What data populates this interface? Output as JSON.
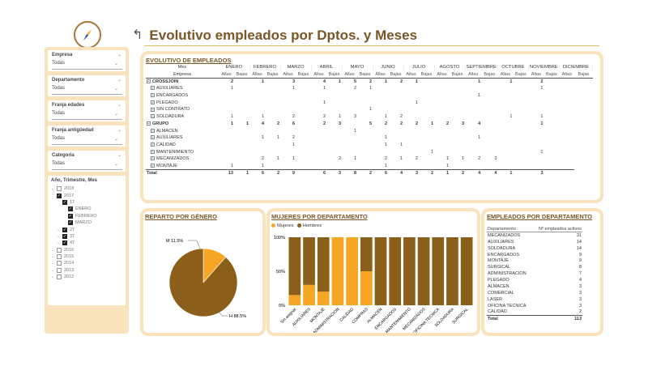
{
  "header": {
    "title": "Evolutivo empleados por Dptos. y Meses"
  },
  "colors": {
    "accent": "#f6a623",
    "brown": "#8b5e1a",
    "panel_bg": "#f9e3bd"
  },
  "filters": [
    {
      "label": "Empresa",
      "value": "Todas"
    },
    {
      "label": "Departamento",
      "value": "Todas"
    },
    {
      "label": "Franja edades",
      "value": "Todas"
    },
    {
      "label": "Franja antigüedad",
      "value": "Todas"
    },
    {
      "label": "Categoria",
      "value": "Todas"
    }
  ],
  "date_tree": {
    "title": "Año, Trimestre, Mes",
    "items": [
      {
        "label": "2018",
        "level": 0,
        "checked": false,
        "exp": "v"
      },
      {
        "label": "2017",
        "level": 0,
        "checked": true,
        "exp": "^"
      },
      {
        "label": "1T",
        "level": 1,
        "checked": true,
        "exp": "^"
      },
      {
        "label": "ENERO",
        "level": 2,
        "checked": true,
        "exp": ""
      },
      {
        "label": "FEBRERO",
        "level": 2,
        "checked": true,
        "exp": ""
      },
      {
        "label": "MARZO",
        "level": 2,
        "checked": true,
        "exp": ""
      },
      {
        "label": "2T",
        "level": 1,
        "checked": true,
        "exp": "v"
      },
      {
        "label": "3T",
        "level": 1,
        "checked": true,
        "exp": "v"
      },
      {
        "label": "4T",
        "level": 1,
        "checked": true,
        "exp": "v"
      },
      {
        "label": "2016",
        "level": 0,
        "checked": false,
        "exp": "v"
      },
      {
        "label": "2015",
        "level": 0,
        "checked": false,
        "exp": "v"
      },
      {
        "label": "2014",
        "level": 0,
        "checked": false,
        "exp": "v"
      },
      {
        "label": "2013",
        "level": 0,
        "checked": false,
        "exp": "v"
      },
      {
        "label": "2012",
        "level": 0,
        "checked": false,
        "exp": "v"
      }
    ]
  },
  "evolutivo": {
    "title": "EVOLUTIVO DE EMPLEADOS",
    "corner_top": "Mes",
    "corner_bottom": "Empresa",
    "months": [
      "ENERO",
      "FEBRERO",
      "MARZO",
      "ABRIL",
      "MAYO",
      "JUNIO",
      "JULIO",
      "AGOSTO",
      "SEPTIEMBRE",
      "OCTUBRE",
      "NOVIEMBRE",
      "DICIEMBRE"
    ],
    "altas": "Altas",
    "bajas": "Bajas",
    "rows": [
      {
        "name": "CROSSJOIN",
        "group": true,
        "vals": [
          "2",
          "",
          "1",
          "",
          "3",
          "",
          "4",
          "1",
          "5",
          "2",
          "1",
          "2",
          "1",
          "",
          "",
          "",
          "1",
          "",
          "1",
          "",
          "2",
          "",
          ""
        ]
      },
      {
        "name": "AUXILIARES",
        "vals": [
          "1",
          "",
          "",
          "",
          "1",
          "",
          "1",
          "",
          "2",
          "1",
          "",
          "",
          "",
          "",
          "",
          "",
          "",
          "",
          "",
          "",
          "1",
          "",
          ""
        ]
      },
      {
        "name": "ENCARGADOS",
        "vals": [
          "",
          "",
          "",
          "",
          "",
          "",
          "",
          "",
          "",
          "",
          "",
          "",
          "",
          "",
          "",
          "",
          "1",
          "",
          "",
          "",
          "",
          "",
          ""
        ]
      },
      {
        "name": "PLEGADO",
        "vals": [
          "",
          "",
          "",
          "",
          "",
          "",
          "1",
          "",
          "",
          "",
          "",
          "",
          "1",
          "",
          "",
          "",
          "",
          "",
          "",
          "",
          "",
          "",
          ""
        ]
      },
      {
        "name": "SIN CONTRATO",
        "vals": [
          "",
          "",
          "",
          "",
          "",
          "",
          "",
          "",
          "",
          "1",
          "",
          "",
          "",
          "",
          "",
          "",
          "",
          "",
          "",
          "",
          "",
          "",
          ""
        ]
      },
      {
        "name": "SOLDADURA",
        "vals": [
          "1",
          "",
          "1",
          "",
          "2",
          "",
          "2",
          "1",
          "3",
          "",
          "1",
          "2",
          "",
          "",
          "",
          "",
          "",
          "",
          "1",
          "",
          "1",
          "",
          ""
        ]
      },
      {
        "name": "GRUPO",
        "group": true,
        "vals": [
          "1",
          "1",
          "4",
          "2",
          "6",
          "",
          "2",
          "3",
          "",
          "5",
          "2",
          "2",
          "2",
          "1",
          "2",
          "3",
          "4",
          "",
          "",
          "",
          "1",
          "",
          ""
        ]
      },
      {
        "name": "ALMACEN",
        "vals": [
          "",
          "",
          "",
          "",
          "",
          "",
          "",
          "",
          "1",
          "",
          "",
          "",
          "",
          "",
          "",
          "",
          "",
          "",
          "",
          "",
          "",
          "",
          ""
        ]
      },
      {
        "name": "AUXILIARES",
        "vals": [
          "",
          "",
          "1",
          "1",
          "2",
          "",
          "",
          "",
          "",
          "",
          "1",
          "",
          "",
          "",
          "",
          "",
          "1",
          "",
          "",
          "",
          "",
          "",
          ""
        ]
      },
      {
        "name": "CALIDAD",
        "vals": [
          "",
          "",
          "",
          "",
          "1",
          "",
          "",
          "",
          "",
          "",
          "1",
          "1",
          "",
          "",
          "",
          "",
          "",
          "",
          "",
          "",
          "",
          "",
          ""
        ]
      },
      {
        "name": "MANTENIMIENTO",
        "vals": [
          "",
          "",
          "",
          "",
          "",
          "",
          "",
          "",
          "",
          "",
          "",
          "",
          "",
          "1",
          "",
          "",
          "",
          "",
          "",
          "",
          "1",
          "",
          ""
        ]
      },
      {
        "name": "MECANIZADOS",
        "vals": [
          "",
          "",
          "2",
          "1",
          "1",
          "",
          "",
          "2",
          "1",
          "",
          "2",
          "1",
          "2",
          "",
          "1",
          "1",
          "2",
          "3",
          "",
          "",
          "",
          "",
          ""
        ]
      },
      {
        "name": "MONTAJE",
        "vals": [
          "1",
          "",
          "1",
          "",
          "",
          "",
          "",
          "",
          "",
          "",
          "1",
          "",
          "",
          "",
          "1",
          "",
          "",
          "",
          "",
          "",
          "",
          "",
          ""
        ]
      }
    ],
    "total_label": "Total",
    "totals": [
      "13",
      "1",
      "6",
      "2",
      "9",
      "",
      "6",
      "3",
      "8",
      "2",
      "6",
      "4",
      "3",
      "2",
      "1",
      "2",
      "4",
      "4",
      "1",
      "",
      "3",
      "",
      ""
    ]
  },
  "reparto": {
    "title": "REPARTO POR GÉNERO",
    "m_label": "M 11.5%",
    "h_label": "H 88.5%"
  },
  "mujeres": {
    "title": "MUJERES POR DEPARTAMENTO",
    "legend": [
      "Mujeres",
      "Hombres"
    ],
    "y_ticks": [
      "100%",
      "50%",
      "0%"
    ]
  },
  "chart_data": {
    "type": "bar",
    "stacked": true,
    "categories": [
      "Sin asignar",
      "AUXILIARES",
      "MONTAJE",
      "ADMINISTRACION",
      "CALIDAD",
      "COMPRAS",
      "ALMACEN",
      "ENCARGADOS",
      "MANTENIMIENTO",
      "MECANIZADOS",
      "OFICINA TECNICA",
      "SOLDADURA",
      "SURGICAL"
    ],
    "series": [
      {
        "name": "Mujeres",
        "values": [
          15,
          30,
          20,
          100,
          100,
          50,
          0,
          0,
          0,
          0,
          0,
          0,
          0
        ]
      },
      {
        "name": "Hombres",
        "values": [
          85,
          70,
          80,
          0,
          0,
          50,
          100,
          100,
          100,
          100,
          100,
          100,
          100
        ]
      }
    ],
    "ylim": [
      0,
      100
    ],
    "pie": {
      "series": [
        {
          "name": "M",
          "value": 11.5
        },
        {
          "name": "H",
          "value": 88.5
        }
      ]
    }
  },
  "empdep": {
    "title": "EMPLEADOS POR DEPARTAMENTO",
    "col1": "Departamento",
    "col2": "Nº empleados activos",
    "rows": [
      {
        "name": "MECANIZADOS",
        "value": "31"
      },
      {
        "name": "AUXILIARES",
        "value": "14"
      },
      {
        "name": "SOLDADURA",
        "value": "14"
      },
      {
        "name": "ENCARGADOS",
        "value": "9"
      },
      {
        "name": "MONTAJE",
        "value": "9"
      },
      {
        "name": "SURGICAL",
        "value": "8"
      },
      {
        "name": "ADMINISTRACION",
        "value": "7"
      },
      {
        "name": "PLEGADO",
        "value": "4"
      },
      {
        "name": "ALMACEN",
        "value": "3"
      },
      {
        "name": "COMERCIAL",
        "value": "3"
      },
      {
        "name": "LASER",
        "value": "3"
      },
      {
        "name": "OFICINA TECNICA",
        "value": "3"
      },
      {
        "name": "CALIDAD",
        "value": "2"
      }
    ],
    "total_label": "Total",
    "total": "113"
  }
}
